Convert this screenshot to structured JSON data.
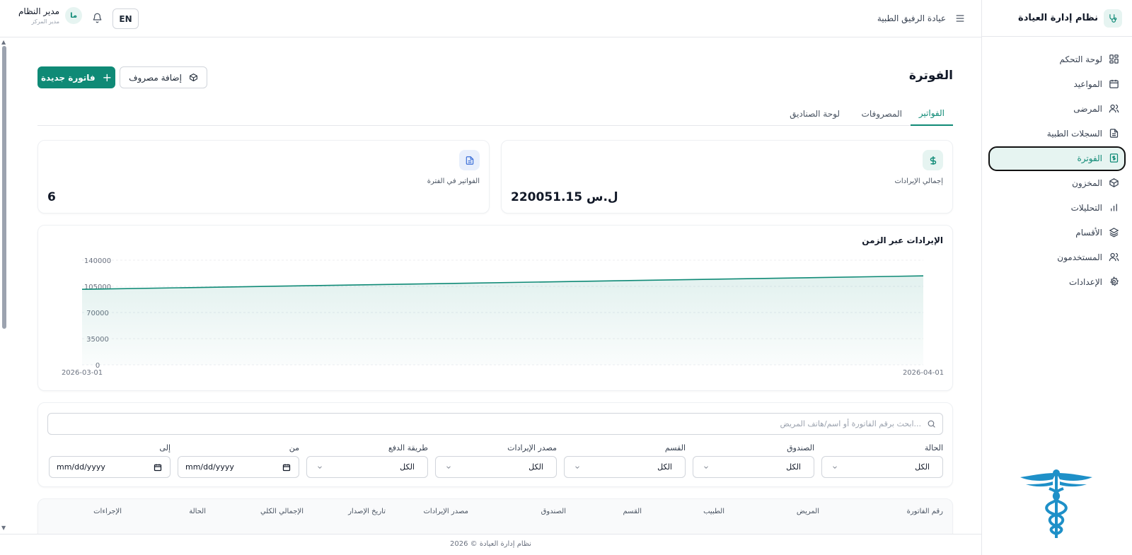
{
  "app": {
    "name": "نظام إدارة العيادة"
  },
  "topbar": {
    "clinic_name": "عيادة الرفيق الطبية",
    "lang_button": "EN",
    "user_name": "مدير النظام",
    "user_role": "مدير المركز",
    "avatar_initials": "ما"
  },
  "sidebar": {
    "items": [
      {
        "label": "لوحة التحكم",
        "icon": "dashboard-icon"
      },
      {
        "label": "المواعيد",
        "icon": "calendar-icon"
      },
      {
        "label": "المرضى",
        "icon": "users-icon"
      },
      {
        "label": "السجلات الطبية",
        "icon": "document-icon"
      },
      {
        "label": "الفوترة",
        "icon": "billing-icon",
        "active": true
      },
      {
        "label": "المخزون",
        "icon": "box-icon"
      },
      {
        "label": "التحليلات",
        "icon": "bar-chart-icon"
      },
      {
        "label": "الأقسام",
        "icon": "layers-icon"
      },
      {
        "label": "المستخدمون",
        "icon": "users-icon"
      },
      {
        "label": "الإعدادات",
        "icon": "gear-icon"
      }
    ]
  },
  "page": {
    "title": "الفوترة",
    "new_invoice": "فاتورة جديدة",
    "add_expense": "إضافة مصروف"
  },
  "tabs": [
    {
      "label": "الفواتير",
      "active": true
    },
    {
      "label": "المصروفات"
    },
    {
      "label": "لوحة الصناديق"
    }
  ],
  "stats": {
    "revenue_label": "إجمالي الإيرادات",
    "revenue_value": "ل.س 220051.15",
    "invoices_label": "الفواتير في الفترة",
    "invoices_value": "6"
  },
  "chart_data": {
    "type": "area",
    "title": "الإيرادات عبر الزمن",
    "x": [
      "2026-03-01",
      "2026-04-01"
    ],
    "y_ticks": [
      "140000",
      "105000",
      "70000",
      "35000",
      "0"
    ],
    "series": [
      {
        "values": [
          101000,
          119000
        ]
      }
    ],
    "ylim": [
      0,
      140000
    ],
    "color": "#0f8a76",
    "grid": true
  },
  "filters": {
    "search_placeholder": "ابحث برقم الفاتورة أو اسم/هاتف المريض...",
    "status_label": "الحالة",
    "fund_label": "الصندوق",
    "department_label": "القسم",
    "revenue_source_label": "مصدر الإيرادات",
    "payment_method_label": "طريقة الدفع",
    "from_label": "من",
    "to_label": "إلى",
    "all": "الكل",
    "date_placeholder": "mm/dd/yyyy"
  },
  "table": {
    "headers": [
      "رقم الفاتورة",
      "المريض",
      "الطبيب",
      "القسم",
      "الصندوق",
      "مصدر الإيرادات",
      "تاريخ الإصدار",
      "الإجمالي الكلي",
      "الحالة",
      "الإجراءات"
    ]
  },
  "footer": {
    "text": "نظام إدارة العيادة © 2026"
  }
}
